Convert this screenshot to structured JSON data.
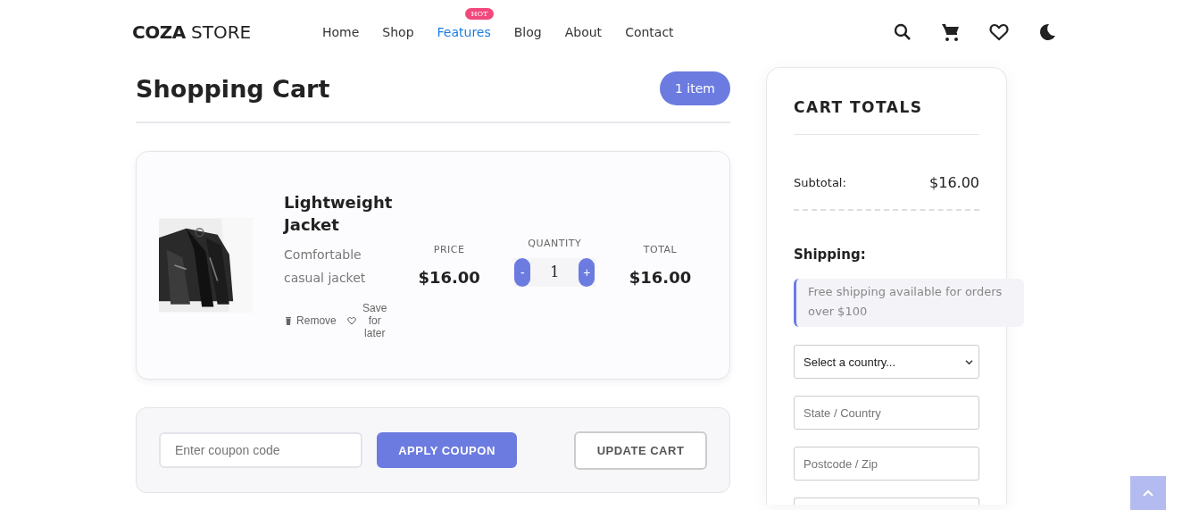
{
  "header": {
    "logo_bold": "COZA",
    "logo_light": "STORE",
    "nav": [
      {
        "label": "Home",
        "selected": false
      },
      {
        "label": "Shop",
        "selected": false
      },
      {
        "label": "Features",
        "selected": true,
        "badge": "HOT"
      },
      {
        "label": "Blog",
        "selected": false
      },
      {
        "label": "About",
        "selected": false
      },
      {
        "label": "Contact",
        "selected": false
      }
    ]
  },
  "cart": {
    "title": "Shopping Cart",
    "count": "1 item",
    "items": [
      {
        "name": "Lightweight Jacket",
        "description": "Comfortable casual jacket",
        "remove": "Remove",
        "save": "Save for later",
        "price_label": "PRICE",
        "price": "$16.00",
        "quantity_label": "QUANTITY",
        "minus": "-",
        "quantity": "1",
        "plus": "+",
        "total_label": "TOTAL",
        "total": "$16.00"
      }
    ],
    "coupon_placeholder": "Enter coupon code",
    "apply": "APPLY COUPON",
    "update": "UPDATE CART"
  },
  "totals": {
    "title": "CART TOTALS",
    "subtotal_label": "Subtotal:",
    "subtotal": "$16.00",
    "shipping_label": "Shipping:",
    "shipping_note": "Free shipping available for orders over $100",
    "country_select": "Select a country...",
    "state_placeholder": "State / Country",
    "postcode_placeholder": "Postcode / Zip"
  }
}
